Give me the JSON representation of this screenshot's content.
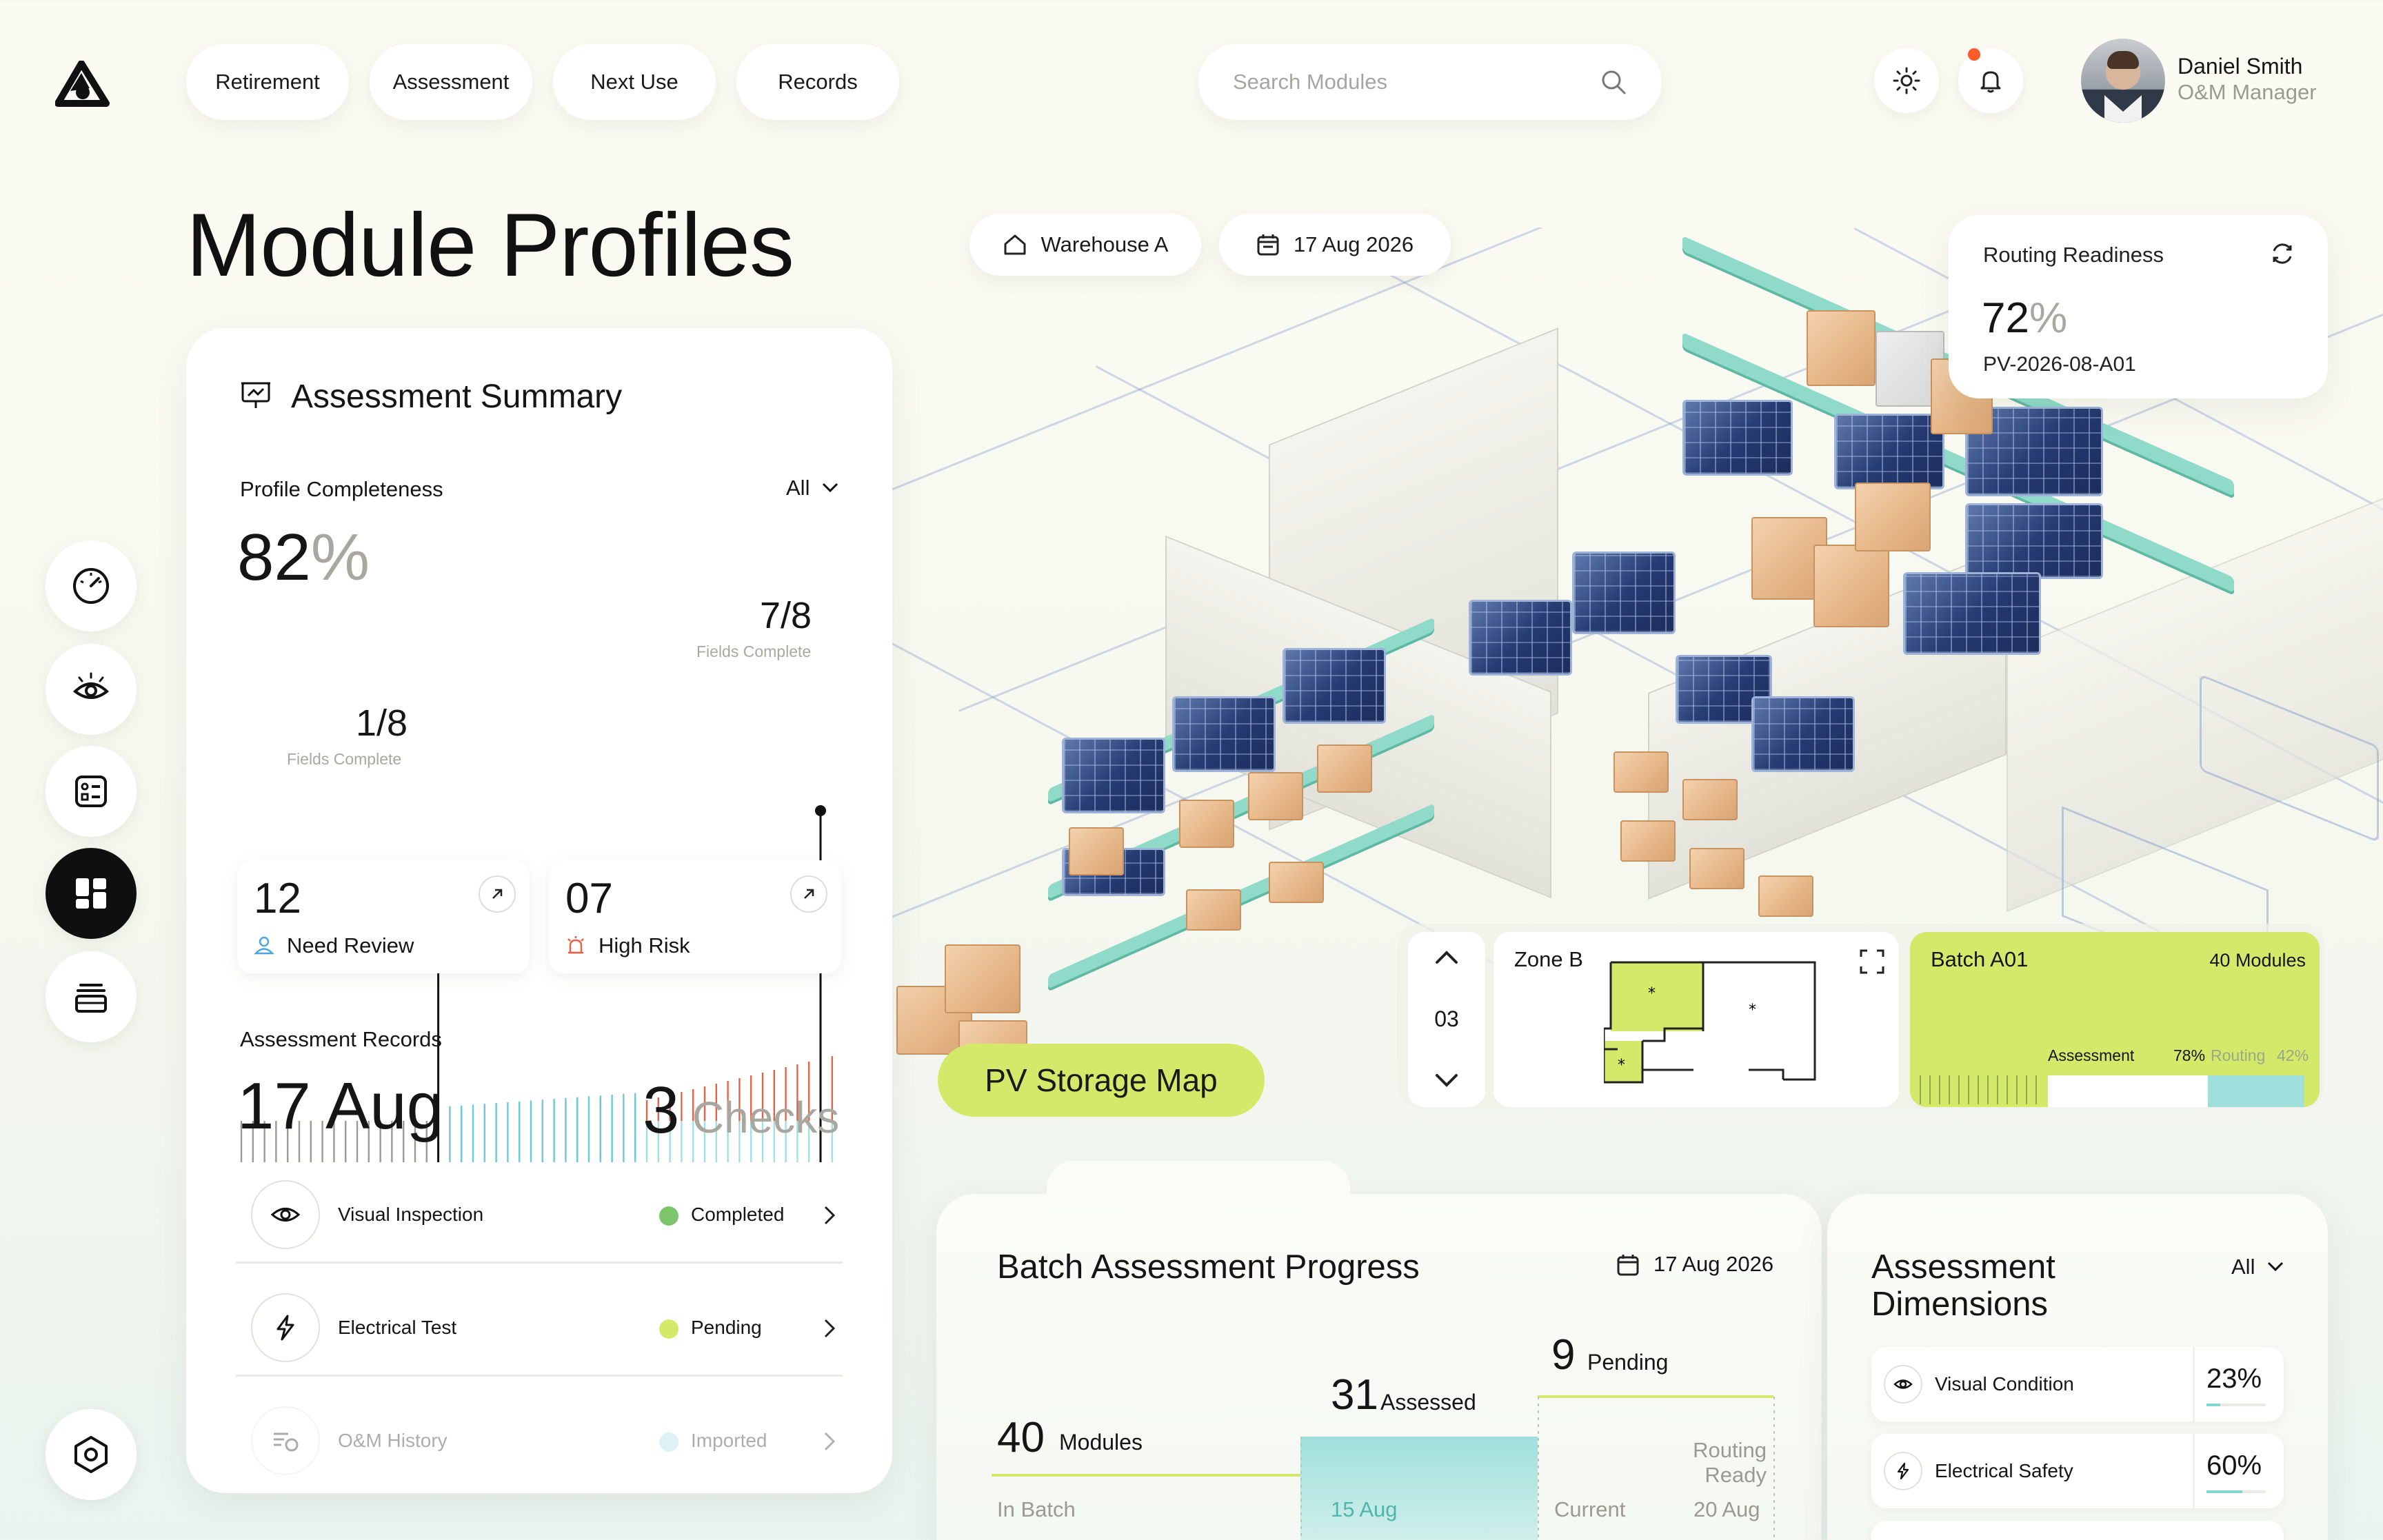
{
  "nav": {
    "items": [
      "Retirement",
      "Assessment",
      "Next Use",
      "Records"
    ],
    "search_placeholder": "Search Modules"
  },
  "user": {
    "name": "Daniel Smith",
    "role": "O&M Manager"
  },
  "page": {
    "title": "Module Profiles"
  },
  "filters": {
    "location": "Warehouse A",
    "date": "17 Aug 2026"
  },
  "routing": {
    "title": "Routing Readiness",
    "value": "72",
    "unit": "%",
    "batch_id": "PV-2026-08-A01"
  },
  "summary": {
    "title": "Assessment Summary",
    "completeness_label": "Profile Completeness",
    "filter": "All",
    "value": "82",
    "unit": "%",
    "marker_high": {
      "value": "7/8",
      "label": "Fields Complete"
    },
    "marker_low": {
      "value": "1/8",
      "label": "Fields Complete"
    },
    "review": {
      "value": "12",
      "label": "Need Review"
    },
    "risk": {
      "value": "07",
      "label": "High Risk"
    },
    "records_label": "Assessment Records",
    "records_date": "17 Aug",
    "records_count": "3",
    "records_unit": "Checks",
    "records": [
      {
        "name": "Visual Inspection",
        "status": "Completed",
        "color": "#7cc56a"
      },
      {
        "name": "Electrical Test",
        "status": "Pending",
        "color": "#d4e96a"
      },
      {
        "name": "O&M History",
        "status": "Imported",
        "color": "#9fd8e8"
      }
    ]
  },
  "map": {
    "label": "PV Storage Map",
    "floor": "03",
    "zone": "Zone B",
    "batch": {
      "name": "Batch A01",
      "count": "40 Modules",
      "assessment_label": "Assessment",
      "assessment_pct": "78%",
      "routing_label": "Routing",
      "routing_pct": "42%",
      "assessment_fraction": 0.78,
      "routing_fraction": 0.42
    }
  },
  "batch_progress": {
    "title": "Batch Assessment Progress",
    "date": "17 Aug 2026",
    "modules_value": "40",
    "modules_label": "Modules",
    "modules_sub": "In Batch",
    "assessed_value": "31",
    "assessed_label": "Assessed",
    "assessed_date": "15 Aug",
    "pending_value": "9",
    "pending_label": "Pending",
    "pending_sub": "Current",
    "routing_label_1": "Routing",
    "routing_label_2": "Ready",
    "routing_date": "20 Aug"
  },
  "dimensions": {
    "title_1": "Assessment",
    "title_2": "Dimensions",
    "filter": "All",
    "items": [
      {
        "label": "Visual Condition",
        "value": "23%",
        "fraction": 0.23
      },
      {
        "label": "Electrical Safety",
        "value": "60%",
        "fraction": 0.6
      }
    ]
  },
  "colors": {
    "accent": "#d4e96a",
    "teal": "#9fe0dc",
    "risk": "#e4644b",
    "dark": "#111111"
  }
}
